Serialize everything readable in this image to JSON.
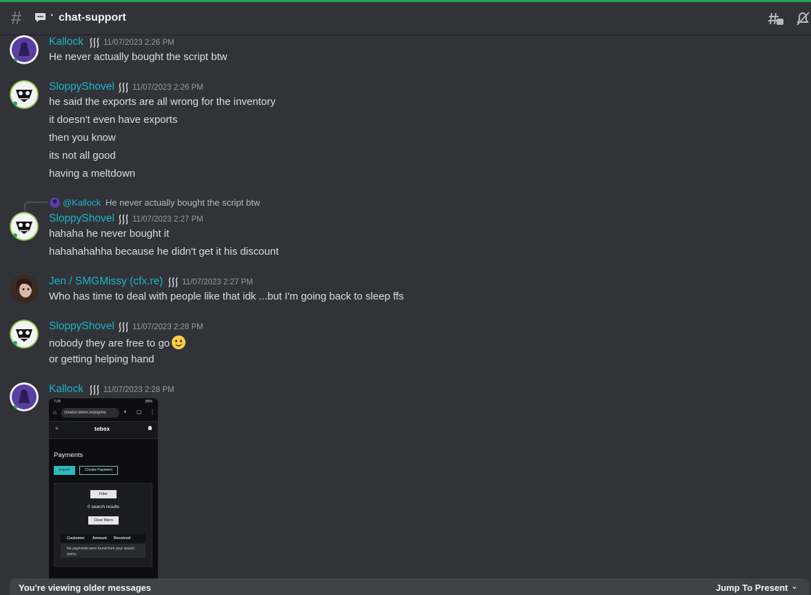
{
  "header": {
    "channel_name": "chat-support",
    "separator": "·"
  },
  "colors": {
    "accent_top": "#23a55a",
    "username": "#1cb5c8",
    "background": "#313338"
  },
  "messages": [
    {
      "author": "Kallock",
      "timestamp": "11/07/2023 2:26 PM",
      "lines": [
        "He never actually bought the script btw"
      ]
    },
    {
      "author": "SloppyShovel",
      "timestamp": "11/07/2023 2:26 PM",
      "lines": [
        "he said the exports are all wrong for the inventory",
        "it doesn't even have exports",
        "then you know",
        "its not all good",
        "having a meltdown"
      ]
    },
    {
      "reply": {
        "mention": "@Kallock",
        "text": "He never actually bought the script btw"
      },
      "author": "SloppyShovel",
      "timestamp": "11/07/2023 2:27 PM",
      "lines": [
        "hahaha he never bought it",
        "hahahahahha because he didn't get it his discount"
      ]
    },
    {
      "author": "Jen / SMGMissy (cfx.re)",
      "timestamp": "11/07/2023 2:27 PM",
      "lines": [
        "Who has time to deal with people like that idk ...but I'm going back to sleep ffs"
      ]
    },
    {
      "author": "SloppyShovel",
      "timestamp": "11/07/2023 2:28 PM",
      "lines": [
        "nobody they are free to go",
        "or getting helping hand"
      ],
      "emoji": "slight-smile-emoji"
    },
    {
      "author": "Kallock",
      "timestamp": "11/07/2023 2:28 PM",
      "attachment": {
        "status_time": "7:28",
        "status_right": "89%",
        "url": "creator.tebex.io/payme",
        "logo": "tebex",
        "page_title": "Payments",
        "export_label": "Export",
        "create_label": "Create Payment",
        "filter_label": "Filter",
        "results_text": "0 search results",
        "clear_label": "Clear filters",
        "columns": [
          "Customer",
          "Amount",
          "Received"
        ],
        "empty_text": "No payments were found from your search query."
      }
    }
  ],
  "footer": {
    "older_text": "You're viewing older messages",
    "jump_label": "Jump To Present"
  }
}
